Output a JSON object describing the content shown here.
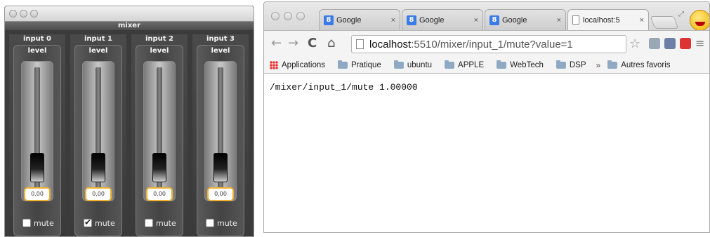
{
  "mixer": {
    "title": "mixer",
    "channels": [
      {
        "name": "input 0",
        "level_label": "level",
        "value": "0,00",
        "mute_label": "mute",
        "muted": false
      },
      {
        "name": "input 1",
        "level_label": "level",
        "value": "0,00",
        "mute_label": "mute",
        "muted": true
      },
      {
        "name": "input 2",
        "level_label": "level",
        "value": "0,00",
        "mute_label": "mute",
        "muted": false
      },
      {
        "name": "input 3",
        "level_label": "level",
        "value": "0,00",
        "mute_label": "mute",
        "muted": false
      }
    ]
  },
  "browser": {
    "tabs": [
      {
        "label": "Google",
        "close": "×"
      },
      {
        "label": "Google",
        "close": "×"
      },
      {
        "label": "Google",
        "close": "×"
      },
      {
        "label": "localhost:5",
        "close": "×"
      }
    ],
    "url_host": "localhost",
    "url_rest": ":5510/mixer/input_1/mute?value=1",
    "bookmarks": [
      "Applications",
      "Pratique",
      "ubuntu",
      "APPLE",
      "WebTech",
      "DSP"
    ],
    "chevron": "»",
    "other_bookmarks": "Autres favoris",
    "page_text": "/mixer/input_1/mute 1.00000",
    "icons": {
      "back": "back-arrow-icon",
      "forward": "forward-arrow-icon",
      "reload": "reload-icon",
      "home": "home-icon",
      "star": "star-icon",
      "menu": "menu-icon"
    }
  }
}
